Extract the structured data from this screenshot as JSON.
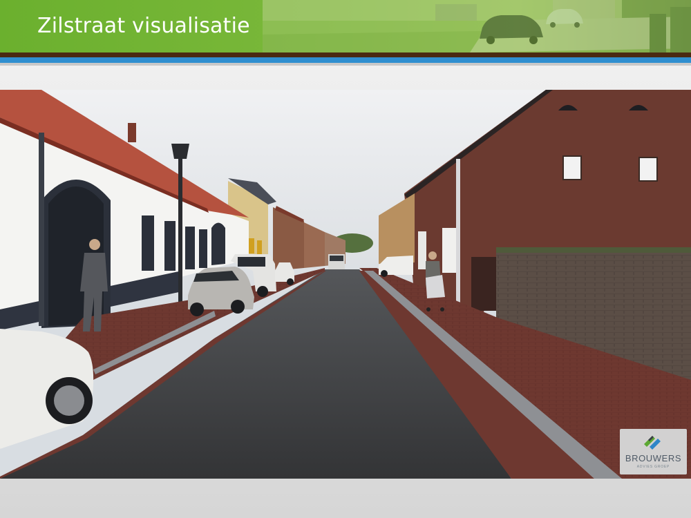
{
  "slide": {
    "title": "Zilstraat visualisatie"
  },
  "visual": {
    "subject": "street-visualization"
  },
  "logo": {
    "name": "BROUWERS",
    "tagline": "ADVIES GROEP"
  },
  "colors": {
    "header_green": "#7ab83a",
    "band_brown": "#4a2a12",
    "band_blue": "#2f8fd0",
    "asphalt": "#3c3d3f",
    "brick_paving": "#7a3a30",
    "logo_text": "#4f5a66"
  }
}
